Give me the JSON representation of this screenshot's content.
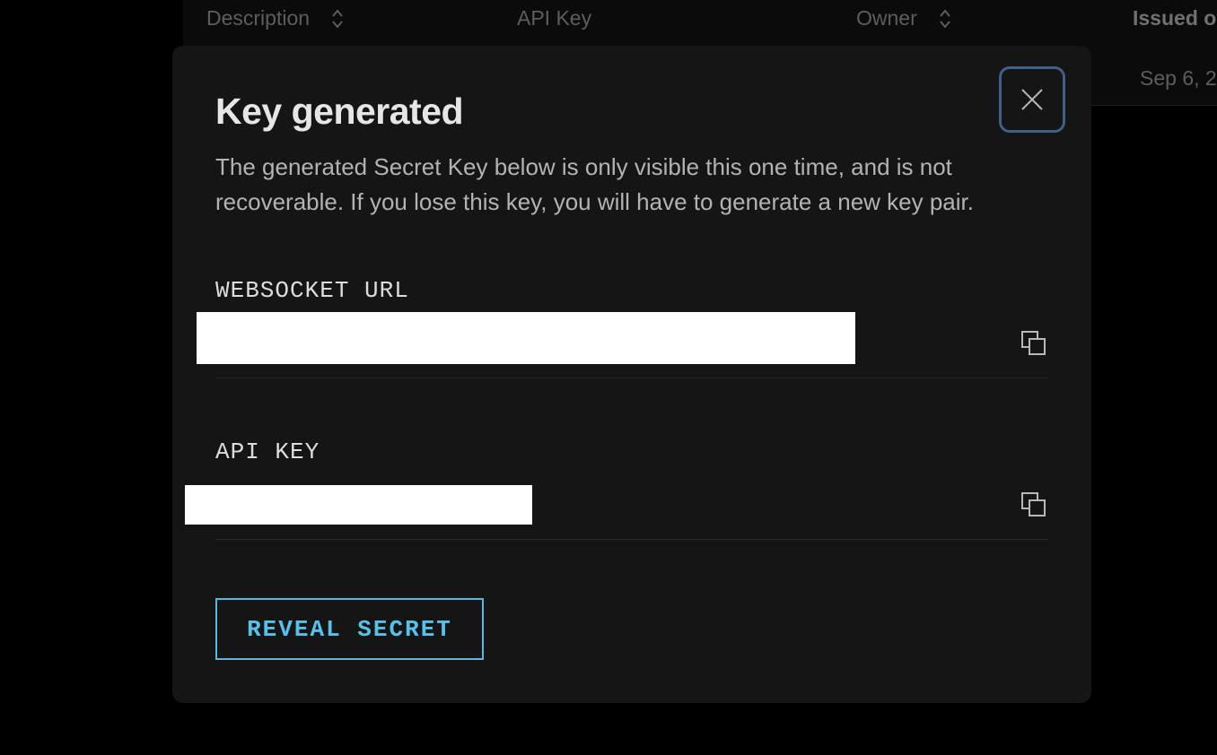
{
  "background_table": {
    "columns": [
      {
        "label": "Description",
        "sortable": true
      },
      {
        "label": "API Key",
        "sortable": false
      },
      {
        "label": "Owner",
        "sortable": true
      },
      {
        "label": "Issued o",
        "sortable": false
      }
    ],
    "row": {
      "issued": "Sep 6, 2"
    }
  },
  "modal": {
    "title": "Key generated",
    "description": "The generated Secret Key below is only visible this one time, and is not recoverable. If you lose this key, you will have to generate a new key pair.",
    "fields": [
      {
        "label": "WEBSOCKET URL",
        "value": ""
      },
      {
        "label": "API KEY",
        "value": ""
      }
    ],
    "reveal_button": "REVEAL SECRET"
  },
  "icons": {
    "close": "close-icon",
    "copy": "copy-icon",
    "sort": "sort-icon"
  },
  "colors": {
    "modal_bg": "#151516",
    "accent": "#55c2eb",
    "close_border": "#3d6189"
  }
}
